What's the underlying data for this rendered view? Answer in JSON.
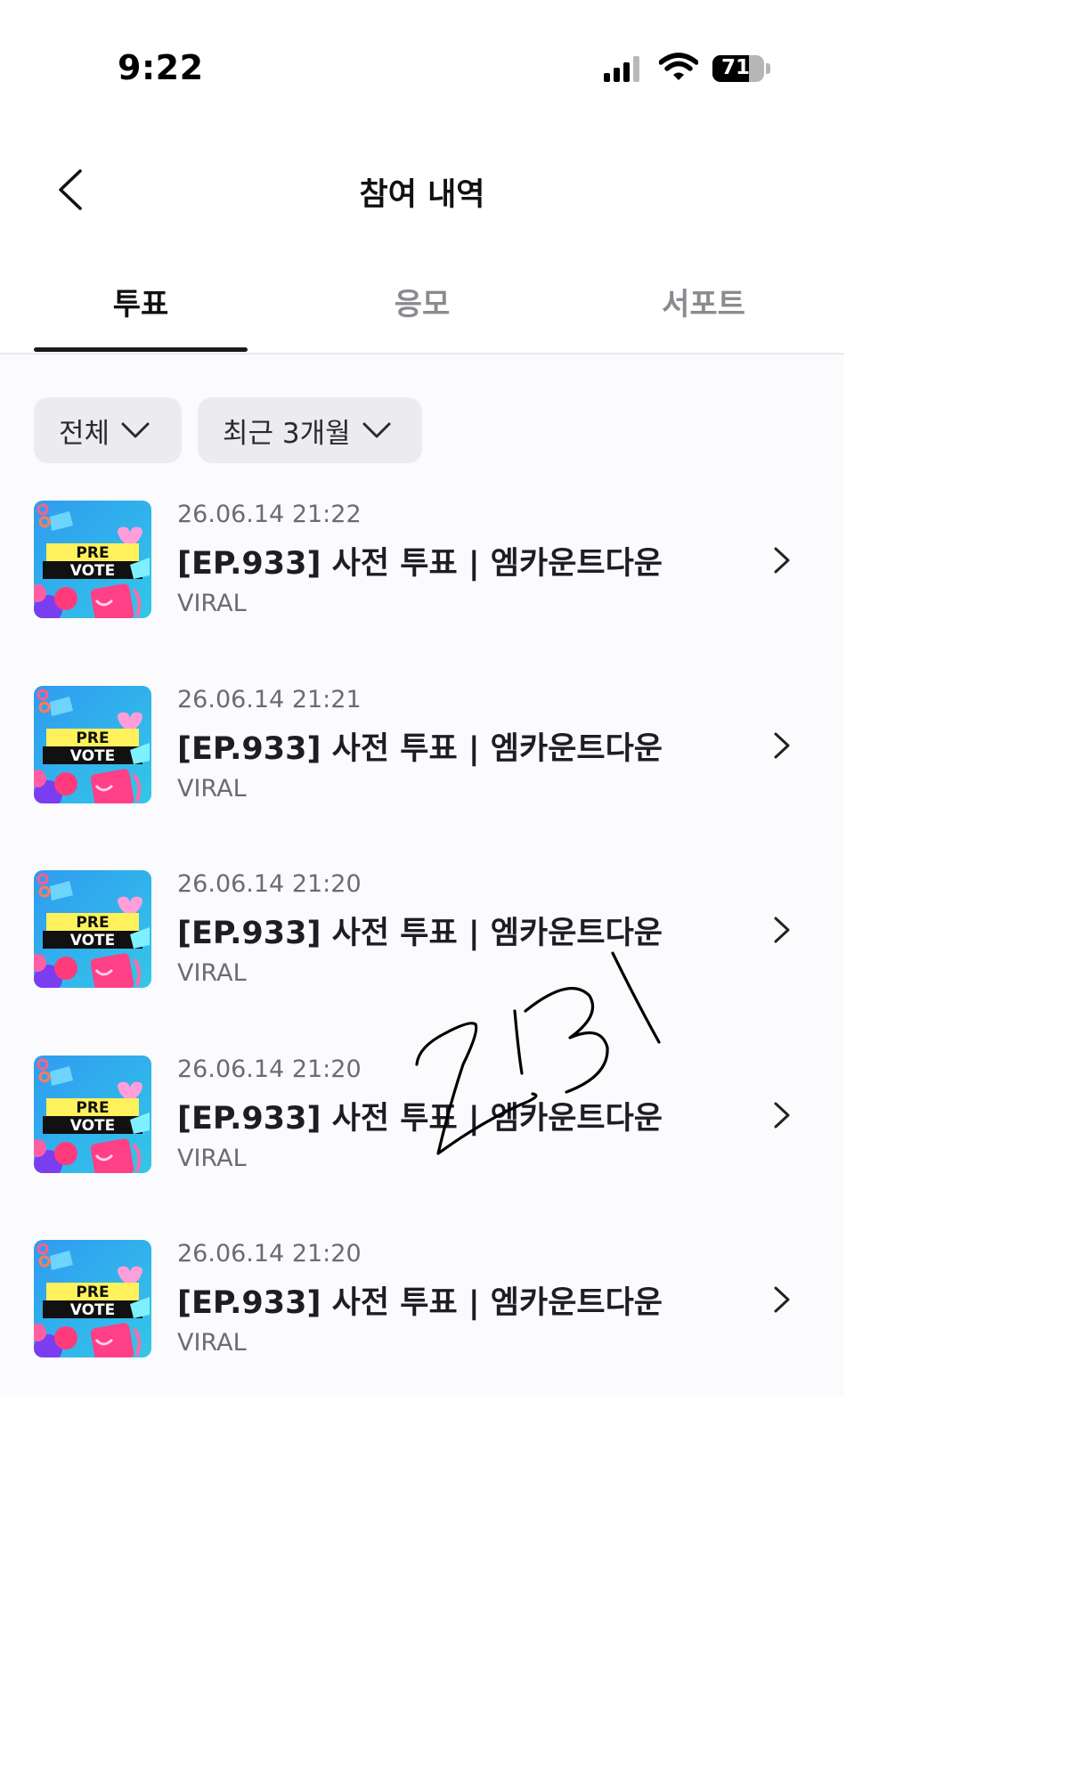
{
  "status_bar": {
    "time": "9:22",
    "battery": "71",
    "battery_level": 0.71,
    "signal_bars": 3,
    "icons": [
      "cellular-signal-icon",
      "wifi-icon",
      "battery-icon"
    ]
  },
  "header": {
    "title": "참여 내역",
    "back_icon": "chevron-left-icon"
  },
  "tabs": [
    {
      "label": "투표",
      "active": true
    },
    {
      "label": "응모",
      "active": false
    },
    {
      "label": "서포트",
      "active": false
    }
  ],
  "filters": [
    {
      "label": "전체",
      "icon": "chevron-down-icon"
    },
    {
      "label": "최근 3개월",
      "icon": "chevron-down-icon"
    }
  ],
  "items": [
    {
      "date": "26.06.14 21:22",
      "title": "[EP.933] 사전 투표 | 엠카운트다운",
      "subtitle": "VIRAL",
      "badge_line1": "PRE",
      "badge_line2": "VOTE"
    },
    {
      "date": "26.06.14 21:21",
      "title": "[EP.933] 사전 투표 | 엠카운트다운",
      "subtitle": "VIRAL",
      "badge_line1": "PRE",
      "badge_line2": "VOTE"
    },
    {
      "date": "26.06.14 21:20",
      "title": "[EP.933] 사전 투표 | 엠카운트다운",
      "subtitle": "VIRAL",
      "badge_line1": "PRE",
      "badge_line2": "VOTE"
    },
    {
      "date": "26.06.14 21:20",
      "title": "[EP.933] 사전 투표 | 엠카운트다운",
      "subtitle": "VIRAL",
      "badge_line1": "PRE",
      "badge_line2": "VOTE"
    },
    {
      "date": "26.06.14 21:20",
      "title": "[EP.933] 사전 투표 | 엠카운트다운",
      "subtitle": "VIRAL",
      "badge_line1": "PRE",
      "badge_line2": "VOTE"
    }
  ],
  "handwritten_annotation": "ZBI",
  "colors": {
    "accent": "#1a1a1a",
    "inactive_tab": "#8a8a8f",
    "chip_bg": "#ececef",
    "thumb_bg": "#2f9bf0",
    "thumb_badge": "#fff15c"
  }
}
